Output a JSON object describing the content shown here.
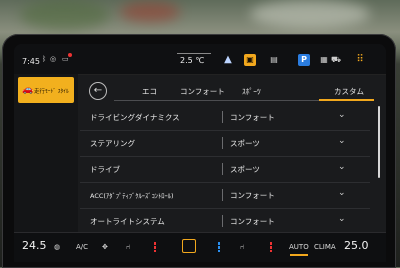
{
  "status": {
    "clock": "7:45",
    "temperature": "2.5 ℃"
  },
  "sidebar": {
    "selected_label": "走行ﾓｰﾄﾞ ｽﾀｲﾙ"
  },
  "tabs": [
    "エコ",
    "コンフォート",
    "ｽﾎﾟｰﾂ",
    "カスタム"
  ],
  "active_tab": "カスタム",
  "settings": [
    {
      "name": "ドライビングダイナミクス",
      "value": "コンフォート"
    },
    {
      "name": "ステアリング",
      "value": "スポーツ"
    },
    {
      "name": "ドライブ",
      "value": "スポーツ"
    },
    {
      "name": "ACC(ｱﾀﾞﾌﾟﾃｨﾌﾞｸﾙｰｽﾞｺﾝﾄﾛｰﾙ)",
      "value": "コンフォート"
    },
    {
      "name": "オートライトシステム",
      "value": "コンフォート"
    }
  ],
  "climate": {
    "left_temp": "24.5",
    "right_temp": "25.0",
    "ac_label": "A/C",
    "auto_label": "AUTO",
    "clima_label": "CLIMA"
  },
  "colors": {
    "accent": "#f2a81d",
    "selected_bg": "#f2b01e"
  }
}
